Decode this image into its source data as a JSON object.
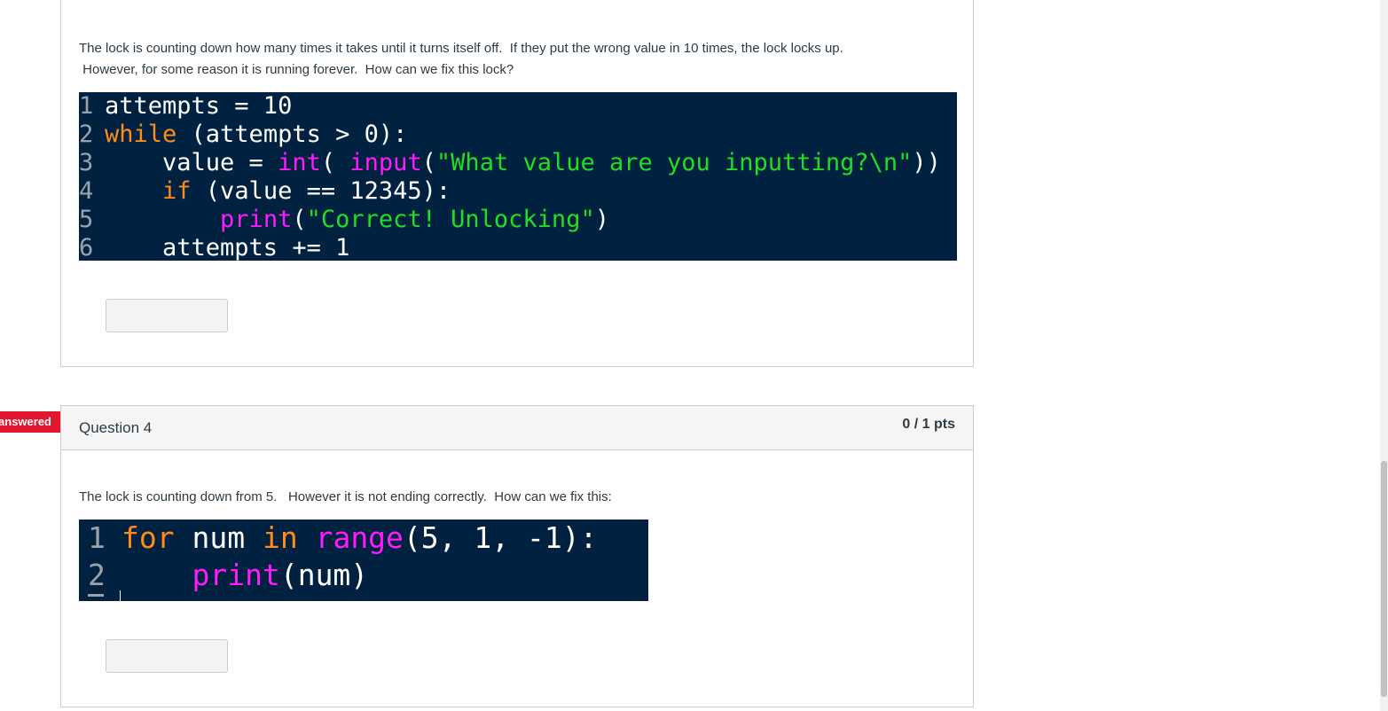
{
  "question3": {
    "text_line1": "The lock is counting down how many times it takes until it turns itself off.  If they put the wrong value in 10 times, the lock locks up.",
    "text_line2": " However, for some reason it is running forever.  How can we fix this lock?",
    "code": {
      "line_numbers": [
        "1",
        "2",
        "3",
        "4",
        "5",
        "6"
      ],
      "l1": "attempts = 10",
      "l2_kw": "while",
      "l2_rest": " (attempts > 0):",
      "l3_a": "    value = ",
      "l3_fn1": "int",
      "l3_b": "( ",
      "l3_fn2": "input",
      "l3_c": "(",
      "l3_str": "\"What value are you inputting?\\n\"",
      "l3_d": "))",
      "l4_a": "    ",
      "l4_kw": "if",
      "l4_rest": " (value == 12345):",
      "l5_a": "        ",
      "l5_fn": "print",
      "l5_b": "(",
      "l5_str": "\"Correct! Unlocking\"",
      "l5_c": ")",
      "l6": "    attempts += 1"
    },
    "answer_value": ""
  },
  "question4": {
    "status_badge": "Unanswered",
    "title": "Question 4",
    "points": "0 / 1 pts",
    "text": "The lock is counting down from 5.   However it is not ending correctly.  How can we fix this:",
    "code": {
      "line_numbers": [
        "1",
        "2"
      ],
      "l1_kw1": "for",
      "l1_a": " num ",
      "l1_kw2": "in",
      "l1_b": " ",
      "l1_fn": "range",
      "l1_c": "(5, 1, -1):",
      "l2_a": "    ",
      "l2_fn": "print",
      "l2_b": "(num)"
    },
    "answer_value": ""
  },
  "colors": {
    "code_background": "#002240",
    "keyword": "#ff8c1a",
    "function": "#ff1aff",
    "string": "#22dd22",
    "badge": "#e0172e"
  }
}
